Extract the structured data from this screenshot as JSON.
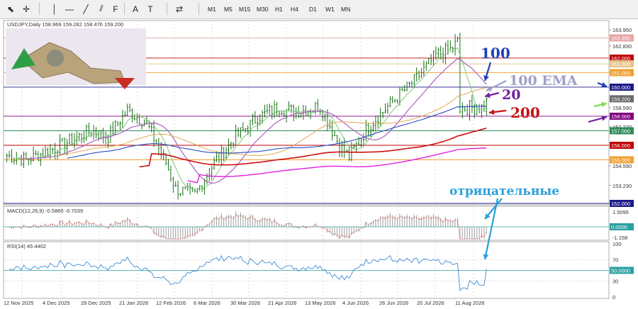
{
  "toolbar": {
    "tools": [
      {
        "name": "cursor-icon",
        "glyph": "⬉"
      },
      {
        "name": "crosshair-icon",
        "glyph": "✛"
      },
      {
        "name": "vertical-line-icon",
        "glyph": "│"
      },
      {
        "name": "horizontal-line-icon",
        "glyph": "—"
      },
      {
        "name": "trendline-icon",
        "glyph": "╱"
      },
      {
        "name": "equidistant-channel-icon",
        "glyph": "⫽"
      },
      {
        "name": "fibonacci-icon",
        "glyph": "F"
      },
      {
        "name": "text-icon",
        "glyph": "A"
      },
      {
        "name": "text-label-icon",
        "glyph": "T"
      },
      {
        "name": "arrow-shapes-icon",
        "glyph": "⇄"
      }
    ],
    "timeframes": [
      "M1",
      "M5",
      "M15",
      "M30",
      "H1",
      "H4",
      "D1",
      "W1",
      "MN"
    ]
  },
  "chart": {
    "symbol_info": "USDJPY,Daily  158.969 159.282 158.476 159.200",
    "price_labels": [
      {
        "text": "163.950",
        "color": "#333333"
      },
      {
        "text": "163.390",
        "color": "#e8a4a4"
      },
      {
        "text": "162.830",
        "color": "#333333"
      },
      {
        "text": "162.000",
        "color": "#c00000"
      },
      {
        "text": "161.600",
        "color": "#e8c48a"
      },
      {
        "text": "161.000",
        "color": "#f0a030"
      },
      {
        "text": "160.000",
        "color": "#1a1a8a"
      },
      {
        "text": "159.200",
        "color": "#6a6a6a"
      },
      {
        "text": "158.590",
        "color": "#333333"
      },
      {
        "text": "158.000",
        "color": "#800080"
      },
      {
        "text": "157.270",
        "color": "#333333"
      },
      {
        "text": "157.000",
        "color": "#2e8b57"
      },
      {
        "text": "156.000",
        "color": "#c00000"
      },
      {
        "text": "155.000",
        "color": "#f0a030"
      },
      {
        "text": "154.590",
        "color": "#333333"
      },
      {
        "text": "153.230",
        "color": "#333333"
      },
      {
        "text": "152.000",
        "color": "#1a1a8a"
      }
    ],
    "date_labels": [
      "12 Nov 2025",
      "4 Dec 2025",
      "29 Dec 2025",
      "21 Jan 2026",
      "12 Feb 2026",
      "6 Mar 2026",
      "30 Mar 2026",
      "21 Apr 2026",
      "13 May 2026",
      "4 Jun 2026",
      "26 Jun 2026",
      "20 Jul 2026",
      "11 Aug 2026"
    ],
    "annotations": {
      "ma100": "100",
      "ema100": "100 EMA",
      "ma20": "20",
      "ma200": "200",
      "negative": "отрицательные"
    },
    "colors": {
      "price_bars": "#006400",
      "ma20": "#7fc97f",
      "ma50": "#b060c0",
      "ma100": "#2a4fbf",
      "ema100": "#e0a040",
      "ma200": "#cc1111",
      "ma_long": "#e020e0",
      "annotation_blue": "#1f3fbf",
      "annotation_grey": "#a0a0c8",
      "annotation_purple": "#7020a0",
      "annotation_red": "#cc1111",
      "annotation_cyan": "#2aa0d8"
    }
  },
  "macd": {
    "label": "MACD(12,26,9) -0.5865 -0.7039",
    "scale": [
      {
        "text": "1.5095",
        "color": "#333333"
      },
      {
        "text": "0.0000",
        "color": "#2aa0a0"
      },
      {
        "text": "-1.158",
        "color": "#333333"
      }
    ]
  },
  "rsi": {
    "label": "RSI(14) 45.4402",
    "scale": [
      {
        "text": "100",
        "color": "#333333"
      },
      {
        "text": "70",
        "color": "#333333"
      },
      {
        "text": "50.0000",
        "color": "#2aa0a0"
      },
      {
        "text": "30",
        "color": "#333333"
      },
      {
        "text": "0",
        "color": "#333333"
      }
    ]
  }
}
